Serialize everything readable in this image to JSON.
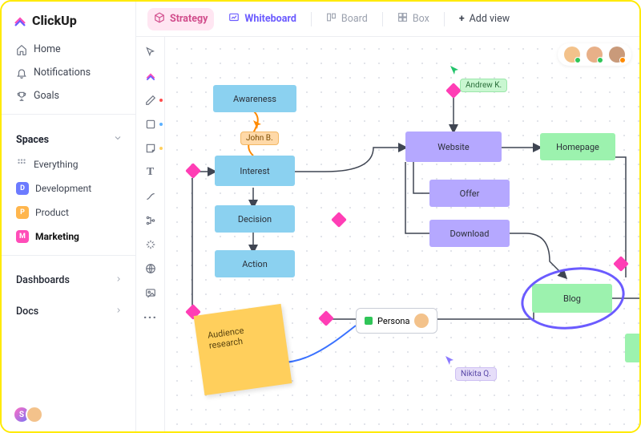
{
  "brand": {
    "name": "ClickUp"
  },
  "sidebar": {
    "nav": [
      {
        "label": "Home",
        "icon": "home-icon"
      },
      {
        "label": "Notifications",
        "icon": "bell-icon"
      },
      {
        "label": "Goals",
        "icon": "trophy-icon"
      }
    ],
    "spaces_label": "Spaces",
    "everything_label": "Everything",
    "spaces": [
      {
        "label": "Development",
        "letter": "D",
        "color": "#6c7bff"
      },
      {
        "label": "Product",
        "letter": "P",
        "color": "#ffb64d"
      },
      {
        "label": "Marketing",
        "letter": "M",
        "color": "#ff4db8"
      }
    ],
    "dashboards_label": "Dashboards",
    "docs_label": "Docs"
  },
  "topbar": {
    "strategy": "Strategy",
    "whiteboard": "Whiteboard",
    "board": "Board",
    "box": "Box",
    "add_view": "Add view"
  },
  "toolstrip": [
    "cursor-icon",
    "clickup-icon",
    "pen-icon",
    "square-icon",
    "sticky-icon",
    "text-icon",
    "connector-icon",
    "branch-icon",
    "star-icon",
    "globe-icon",
    "image-icon",
    "more-icon"
  ],
  "nodes": {
    "awareness": "Awareness",
    "interest": "Interest",
    "decision": "Decision",
    "action": "Action",
    "website": "Website",
    "offer": "Offer",
    "download": "Download",
    "homepage": "Homepage",
    "blog": "Blog",
    "persona": "Persona"
  },
  "tags": {
    "john": "John B.",
    "andrew": "Andrew K.",
    "nikita": "Nikita Q."
  },
  "sticky": {
    "text": "Audience research"
  }
}
